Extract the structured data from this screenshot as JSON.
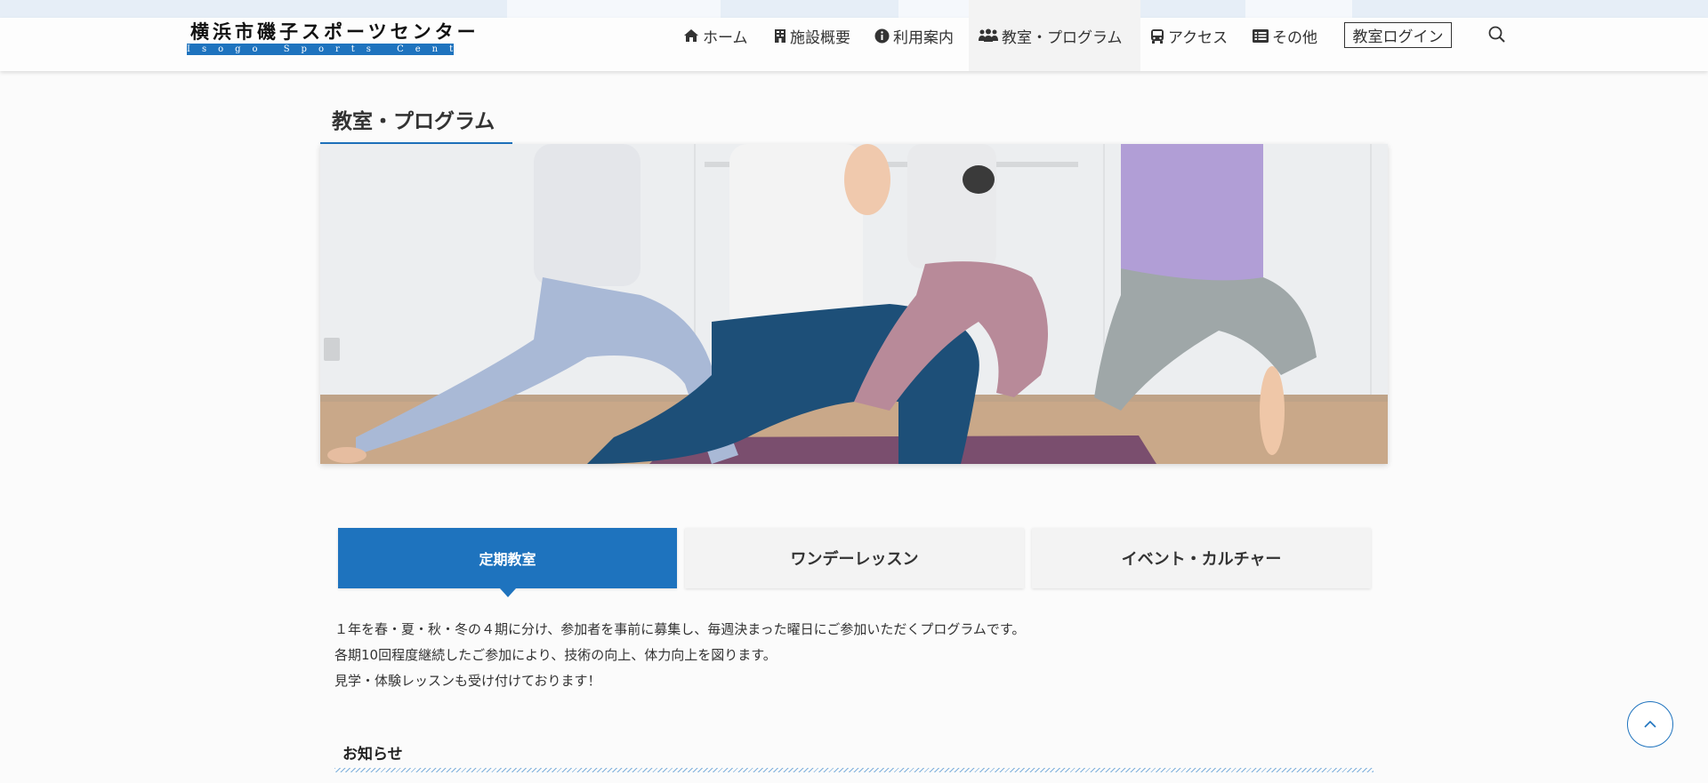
{
  "site": {
    "logo_jp": "横浜市磯子スポーツセンター",
    "logo_en": "Isogo Sports Center"
  },
  "nav": {
    "items": [
      {
        "label": "ホーム",
        "icon": "home-icon"
      },
      {
        "label": "施設概要",
        "icon": "building-icon"
      },
      {
        "label": "利用案内",
        "icon": "info-icon"
      },
      {
        "label": "教室・プログラム",
        "icon": "users-icon"
      },
      {
        "label": "アクセス",
        "icon": "bus-icon"
      },
      {
        "label": "その他",
        "icon": "list-icon"
      }
    ],
    "login_label": "教室ログイン",
    "search_icon": "search-icon"
  },
  "page": {
    "title": "教室・プログラム",
    "hero_alt": "yoga-class-photo"
  },
  "tabs": [
    {
      "label": "定期教室",
      "active": true
    },
    {
      "label": "ワンデーレッスン",
      "active": false
    },
    {
      "label": "イベント・カルチャー",
      "active": false
    }
  ],
  "description": {
    "line1": "１年を春・夏・秋・冬の４期に分け、参加者を事前に募集し、毎週決まった曜日にご参加いただくプログラムです。",
    "line2": "各期10回程度継続したご参加により、技術の向上、体力向上を図ります。",
    "line3": "見学・体験レッスンも受け付けております！"
  },
  "notice": {
    "title": "お知らせ"
  },
  "colors": {
    "accent": "#1e73be",
    "tab_bg": "#f3f3f3",
    "page_bg": "#fbfbfb"
  },
  "back_to_top_icon": "chevron-up-icon"
}
